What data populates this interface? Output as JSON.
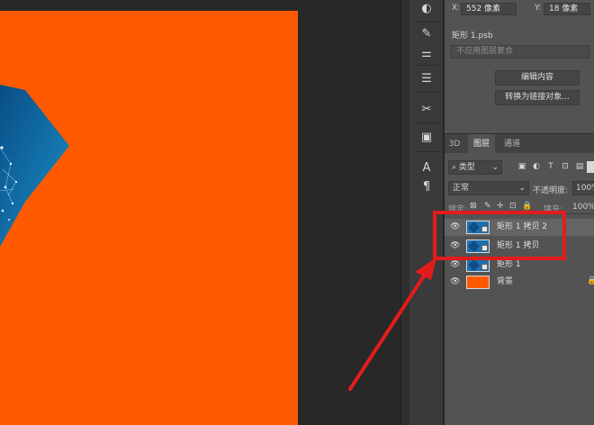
{
  "coords": {
    "x_label": "X:",
    "x_value": "552 像素",
    "y_label": "Y:",
    "y_value": "18 像素"
  },
  "properties": {
    "smart_object_name": "矩形 1.psb",
    "layer_comp_placeholder": "不应用图层复合",
    "edit_contents_button": "编辑内容",
    "convert_linked_button": "转换为链接对象..."
  },
  "tabs": [
    {
      "label": "3D"
    },
    {
      "label": "图层"
    },
    {
      "label": "通道"
    }
  ],
  "filter": {
    "kind_label": "类型",
    "icons": [
      "▣",
      "◐",
      "T",
      "⊡",
      "▤"
    ]
  },
  "blend": {
    "mode": "正常",
    "opacity_label": "不透明度:",
    "opacity_value": "100%"
  },
  "lock": {
    "label": "锁定:",
    "fill_label": "填充:",
    "fill_value": "100%"
  },
  "layers": [
    {
      "name": "矩形 1 拷贝 2",
      "selected": true,
      "type": "smart"
    },
    {
      "name": "矩形 1 拷贝",
      "selected": false,
      "type": "smart"
    },
    {
      "name": "矩形 1",
      "selected": false,
      "type": "smart"
    },
    {
      "name": "背景",
      "selected": false,
      "type": "background"
    }
  ],
  "tools": [
    "◐",
    "✎",
    "⚌",
    "☰",
    "✂",
    "▣",
    "A",
    "¶"
  ],
  "colors": {
    "canvas_fill": "#ff5a00",
    "annotation": "#e21c1c",
    "panel_bg": "#535353"
  }
}
